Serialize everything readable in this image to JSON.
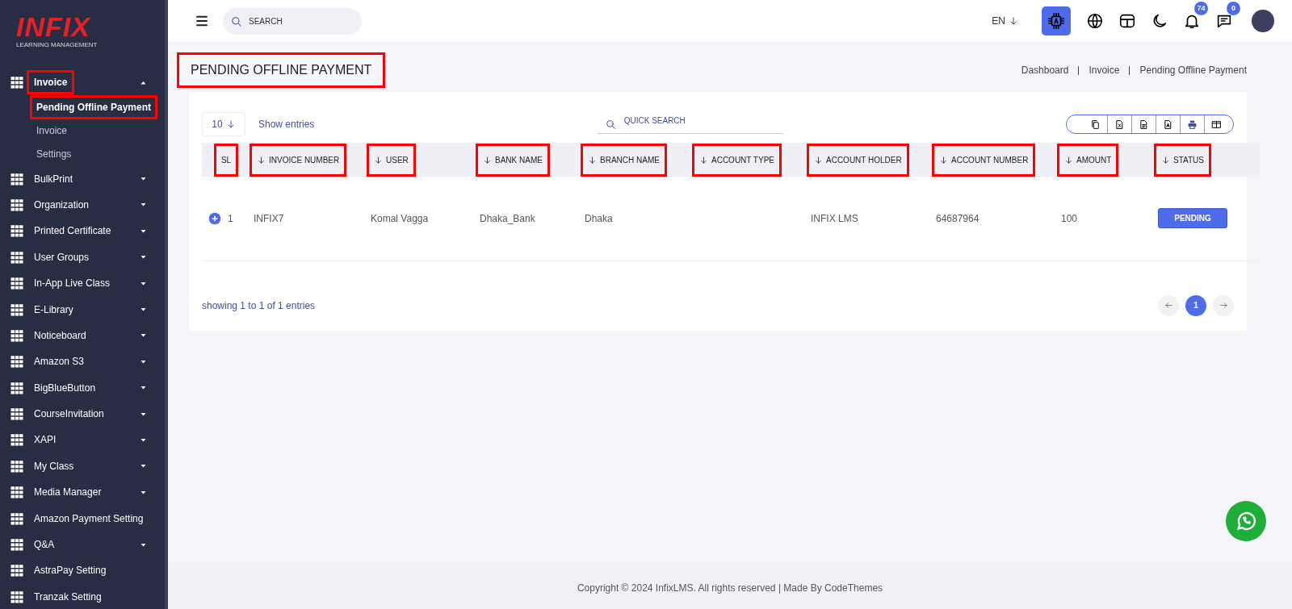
{
  "logo": {
    "brand": "INFIX",
    "tagline": "LEARNING MANAGEMENT"
  },
  "sidebar": {
    "items": [
      {
        "label": "Invoice",
        "expandable": true,
        "expanded": true,
        "highlighted": true,
        "children": [
          {
            "label": "Pending Offline Payment",
            "selected": true,
            "highlighted": true
          },
          {
            "label": "Invoice",
            "selected": false,
            "highlighted": false
          },
          {
            "label": "Settings",
            "selected": false,
            "highlighted": false
          }
        ]
      },
      {
        "label": "BulkPrint",
        "expandable": true,
        "expanded": false,
        "highlighted": false
      },
      {
        "label": "Organization",
        "expandable": true,
        "expanded": false,
        "highlighted": false
      },
      {
        "label": "Printed Certificate",
        "expandable": true,
        "expanded": false,
        "highlighted": false
      },
      {
        "label": "User Groups",
        "expandable": true,
        "expanded": false,
        "highlighted": false
      },
      {
        "label": "In-App Live Class",
        "expandable": true,
        "expanded": false,
        "highlighted": false
      },
      {
        "label": "E-Library",
        "expandable": true,
        "expanded": false,
        "highlighted": false
      },
      {
        "label": "Noticeboard",
        "expandable": true,
        "expanded": false,
        "highlighted": false
      },
      {
        "label": "Amazon S3",
        "expandable": true,
        "expanded": false,
        "highlighted": false
      },
      {
        "label": "BigBlueButton",
        "expandable": true,
        "expanded": false,
        "highlighted": false
      },
      {
        "label": "CourseInvitation",
        "expandable": true,
        "expanded": false,
        "highlighted": false
      },
      {
        "label": "XAPI",
        "expandable": true,
        "expanded": false,
        "highlighted": false
      },
      {
        "label": "My Class",
        "expandable": true,
        "expanded": false,
        "highlighted": false
      },
      {
        "label": "Media Manager",
        "expandable": true,
        "expanded": false,
        "highlighted": false
      },
      {
        "label": "Amazon Payment Setting",
        "expandable": false,
        "expanded": false,
        "highlighted": false
      },
      {
        "label": "Q&A",
        "expandable": true,
        "expanded": false,
        "highlighted": false
      },
      {
        "label": "AstraPay Setting",
        "expandable": false,
        "expanded": false,
        "highlighted": false
      },
      {
        "label": "Tranzak Setting",
        "expandable": false,
        "expanded": false,
        "highlighted": false
      }
    ]
  },
  "header": {
    "search": {
      "placeholder": "SEARCH"
    },
    "language": "EN",
    "notifications": "74",
    "messages": "0"
  },
  "page": {
    "title": "PENDING OFFLINE PAYMENT",
    "title_highlighted": true,
    "breadcrumb": [
      "Dashboard",
      "Invoice",
      "Pending Offline Payment"
    ]
  },
  "table": {
    "page_size": "10",
    "show_entries": "Show entries",
    "quick_search": {
      "placeholder": "QUICK SEARCH"
    },
    "columns": [
      {
        "label": "SL",
        "sortable": false,
        "highlighted": true
      },
      {
        "label": "INVOICE NUMBER",
        "sortable": true,
        "highlighted": true
      },
      {
        "label": "USER",
        "sortable": true,
        "highlighted": true
      },
      {
        "label": "BANK NAME",
        "sortable": true,
        "highlighted": true
      },
      {
        "label": "BRANCH NAME",
        "sortable": true,
        "highlighted": true
      },
      {
        "label": "ACCOUNT TYPE",
        "sortable": true,
        "highlighted": true
      },
      {
        "label": "ACCOUNT HOLDER",
        "sortable": true,
        "highlighted": true
      },
      {
        "label": "ACCOUNT NUMBER",
        "sortable": true,
        "highlighted": true
      },
      {
        "label": "AMOUNT",
        "sortable": true,
        "highlighted": true
      },
      {
        "label": "STATUS",
        "sortable": true,
        "highlighted": true
      }
    ],
    "rows": [
      {
        "cells": [
          "1",
          "INFIX7",
          "Komal Vagga",
          "Dhaka_Bank",
          "Dhaka",
          "",
          "INFIX LMS",
          "64687964",
          "100"
        ],
        "status": "PENDING"
      }
    ],
    "info": "showing 1 to 1 of 1 entries",
    "pages": [
      {
        "label": "1",
        "selected": true
      }
    ]
  },
  "footer": "Copyright © 2024 InfixLMS. All rights reserved | Made By CodeThemes"
}
